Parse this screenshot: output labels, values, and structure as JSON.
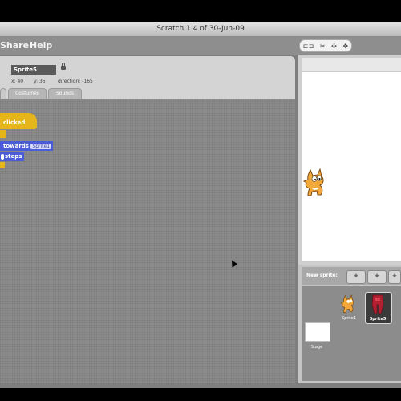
{
  "window": {
    "title": "Scratch 1.4 of 30-Jun-09"
  },
  "menubar": {
    "items": [
      "Share",
      "Help"
    ]
  },
  "sprite_info": {
    "name": "Sprite5",
    "x_label": "x: 40",
    "y_label": "y: 35",
    "direction_label": "direction: -165"
  },
  "tabs": [
    "Costumes",
    "Sounds"
  ],
  "script_blocks": {
    "when_clicked": "clicked",
    "go_to_label": "towards",
    "go_to_target": "Sprite1",
    "steps_label": "steps"
  },
  "stage_panel": {
    "new_sprite_label": "New sprite:"
  },
  "sprites": [
    {
      "name": "Sprite1"
    },
    {
      "name": "Sprite5"
    }
  ],
  "stage_thumb_label": "Stage",
  "colors": {
    "event_block": "#e6b51c",
    "motion_block": "#4b5dd6",
    "selected_sprite": "#b02030"
  }
}
